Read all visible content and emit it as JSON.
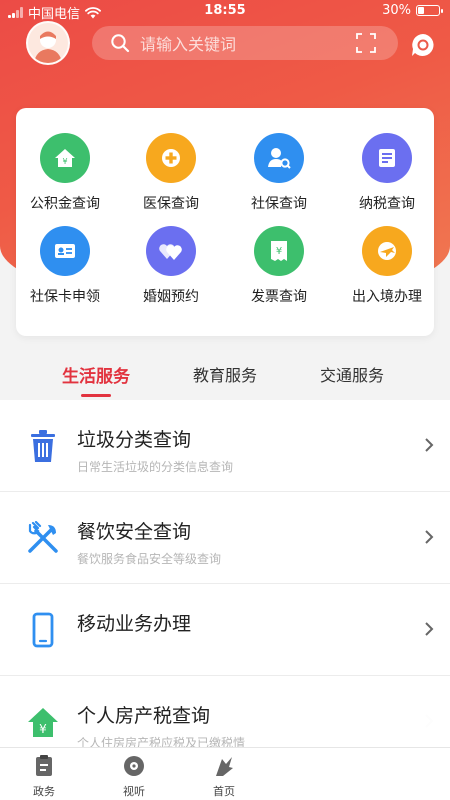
{
  "status_bar": {
    "carrier": "中国电信",
    "time": "18:55",
    "battery": "30%"
  },
  "search": {
    "placeholder": "请输入关键词"
  },
  "services_grid": [
    {
      "label": "公积金查询",
      "icon": "house-yuan-icon",
      "color": "#3dbf6d"
    },
    {
      "label": "医保查询",
      "icon": "medical-cross-icon",
      "color": "#f7a81e"
    },
    {
      "label": "社保查询",
      "icon": "user-search-icon",
      "color": "#2f8ff0"
    },
    {
      "label": "纳税查询",
      "icon": "tax-icon",
      "color": "#6b6ff0"
    },
    {
      "label": "社保卡申领",
      "icon": "id-card-icon",
      "color": "#2f8ff0"
    },
    {
      "label": "婚姻预约",
      "icon": "hearts-icon",
      "color": "#6b6ff0"
    },
    {
      "label": "发票查询",
      "icon": "receipt-icon",
      "color": "#3dbf6d"
    },
    {
      "label": "出入境办理",
      "icon": "airplane-globe-icon",
      "color": "#f7a81e"
    }
  ],
  "tabs": [
    {
      "label": "生活服务",
      "active": true
    },
    {
      "label": "教育服务",
      "active": false
    },
    {
      "label": "交通服务",
      "active": false
    }
  ],
  "list": [
    {
      "title": "垃圾分类查询",
      "subtitle": "日常生活垃圾的分类信息查询",
      "icon": "trash-can-icon"
    },
    {
      "title": "餐饮安全查询",
      "subtitle": "餐饮服务食品安全等级查询",
      "icon": "fork-knife-icon"
    },
    {
      "title": "移动业务办理",
      "subtitle": "",
      "icon": "mobile-phone-icon"
    },
    {
      "title": "个人房产税查询",
      "subtitle": "个人住房房产税应税及已缴税情",
      "icon": "house-yuan-icon"
    }
  ],
  "bottom_nav": [
    {
      "label": "政务",
      "icon": "clipboard-icon"
    },
    {
      "label": "视听",
      "icon": "disc-icon"
    },
    {
      "label": "首页",
      "icon": "home-icon"
    }
  ],
  "colors": {
    "primary_red": "#e2333f",
    "hero_gradient_start": "#ec4b46",
    "hero_gradient_end": "#f07a52"
  }
}
